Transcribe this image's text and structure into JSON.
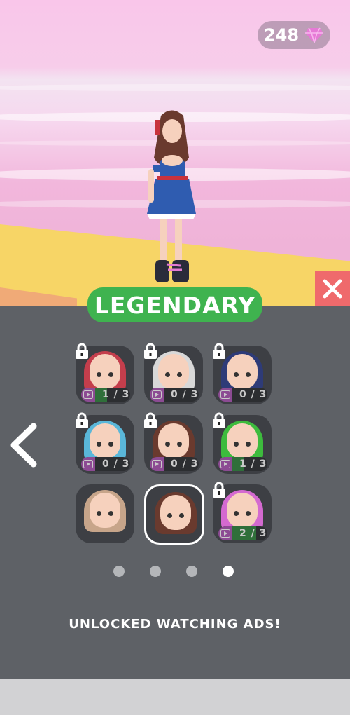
{
  "currency": {
    "amount": "248",
    "icon": "diamond-icon",
    "color": "#e67ad6"
  },
  "tier_label": "LEGENDARY",
  "tier_color": "#3fb34f",
  "close_color": "#ef6a6c",
  "skins": [
    {
      "name": "ram-skull",
      "locked": true,
      "progress": "1/3",
      "progress_fraction": 0.33,
      "hair": "#c43e4c"
    },
    {
      "name": "silver-hair",
      "locked": true,
      "progress": "0/3",
      "progress_fraction": 0,
      "hair": "#d8d8d8"
    },
    {
      "name": "cat-ear-navy",
      "locked": true,
      "progress": "0/3",
      "progress_fraction": 0,
      "hair": "#2e3b78"
    },
    {
      "name": "blue-hat",
      "locked": true,
      "progress": "0/3",
      "progress_fraction": 0,
      "hair": "#5ab7d9"
    },
    {
      "name": "brunette",
      "locked": true,
      "progress": "0/3",
      "progress_fraction": 0,
      "hair": "#6a3a2e"
    },
    {
      "name": "frog-hood",
      "locked": true,
      "progress": "1/3",
      "progress_fraction": 0.33,
      "hair": "#3dbb3d"
    },
    {
      "name": "fox-ears",
      "locked": false,
      "progress": "",
      "progress_fraction": 1,
      "hair": "#c7a58a"
    },
    {
      "name": "current-brunette",
      "locked": false,
      "selected": true,
      "progress": "",
      "progress_fraction": 1,
      "hair": "#6a3a2e"
    },
    {
      "name": "pink-horns",
      "locked": true,
      "progress": "2/3",
      "progress_fraction": 0.67,
      "hair": "#d46ad0"
    }
  ],
  "page_dots": {
    "count": 4,
    "active_index": 3
  },
  "footer_message": "UNLOCKED WATCHING ADS!"
}
